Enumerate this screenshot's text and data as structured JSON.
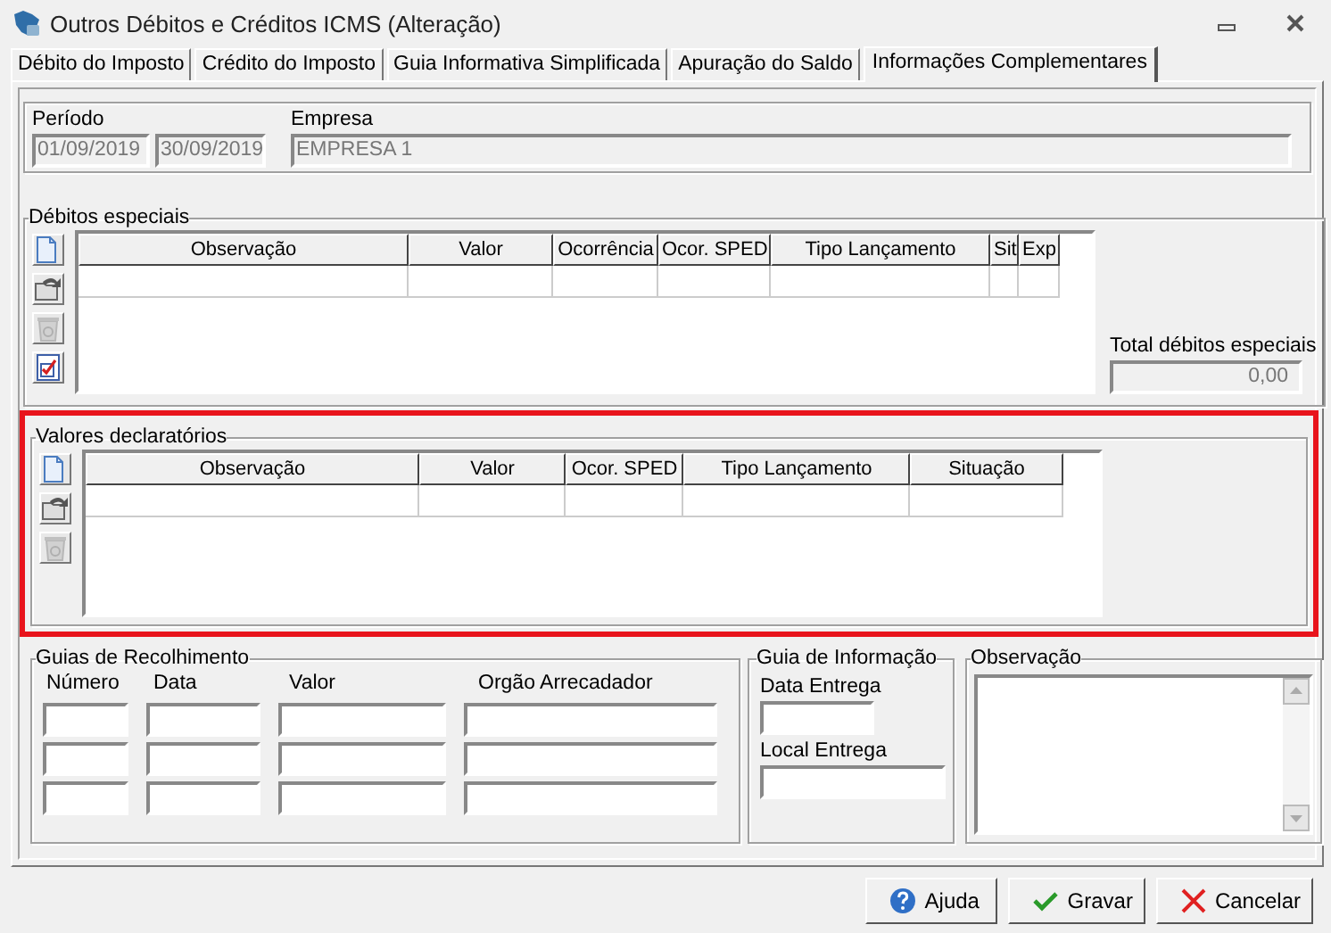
{
  "window": {
    "title": "Outros Débitos e Créditos ICMS (Alteração)"
  },
  "tabs": [
    {
      "label": "Débito do Imposto",
      "selected": false
    },
    {
      "label": "Crédito do Imposto",
      "selected": false
    },
    {
      "label": "Guia Informativa Simplificada",
      "selected": false
    },
    {
      "label": "Apuração do Saldo",
      "selected": false
    },
    {
      "label": "Informações Complementares",
      "selected": true
    }
  ],
  "header": {
    "fields": [
      {
        "kind": "start",
        "label": "Período",
        "value": "01/09/2019",
        "disabled": true
      },
      {
        "kind": "end",
        "value": "30/09/2019",
        "disabled": true
      },
      {
        "kind": "company",
        "label": "Empresa",
        "value": "EMPRESA 1",
        "disabled": true
      }
    ]
  },
  "special_debits": {
    "title": "Débitos especiais",
    "tools": [
      {
        "kind": "new",
        "disabled": false
      },
      {
        "kind": "edit",
        "disabled": false
      },
      {
        "kind": "delete",
        "disabled": true
      },
      {
        "kind": "check",
        "disabled": false
      }
    ],
    "columns": [
      "Observação",
      "Valor",
      "Ocorrência",
      "Ocor. SPED",
      "Tipo Lançamento",
      "Sit",
      "Exp"
    ],
    "total": {
      "label": "Total débitos especiais",
      "value": "0,00",
      "disabled": true
    }
  },
  "declaratory_values": {
    "title": "Valores declaratórios",
    "highlighted": true,
    "tools": [
      {
        "kind": "new",
        "disabled": false
      },
      {
        "kind": "edit",
        "disabled": false
      },
      {
        "kind": "delete",
        "disabled": true
      }
    ],
    "columns": [
      "Observação",
      "Valor",
      "Ocor. SPED",
      "Tipo Lançamento",
      "Situação"
    ]
  },
  "collection_guides": {
    "title": "Guias de Recolhimento",
    "columns": [
      "Número",
      "Data",
      "Valor",
      "Orgão Arrecadador"
    ]
  },
  "info_guide": {
    "title": "Guia de Informação",
    "fields": [
      {
        "label": "Data Entrega"
      },
      {
        "label": "Local Entrega"
      }
    ]
  },
  "notes": {
    "title": "Observação"
  },
  "buttons": [
    {
      "kind": "help",
      "label": "Ajuda"
    },
    {
      "kind": "save",
      "label": "Gravar"
    },
    {
      "kind": "cancel",
      "label": "Cancelar"
    }
  ]
}
